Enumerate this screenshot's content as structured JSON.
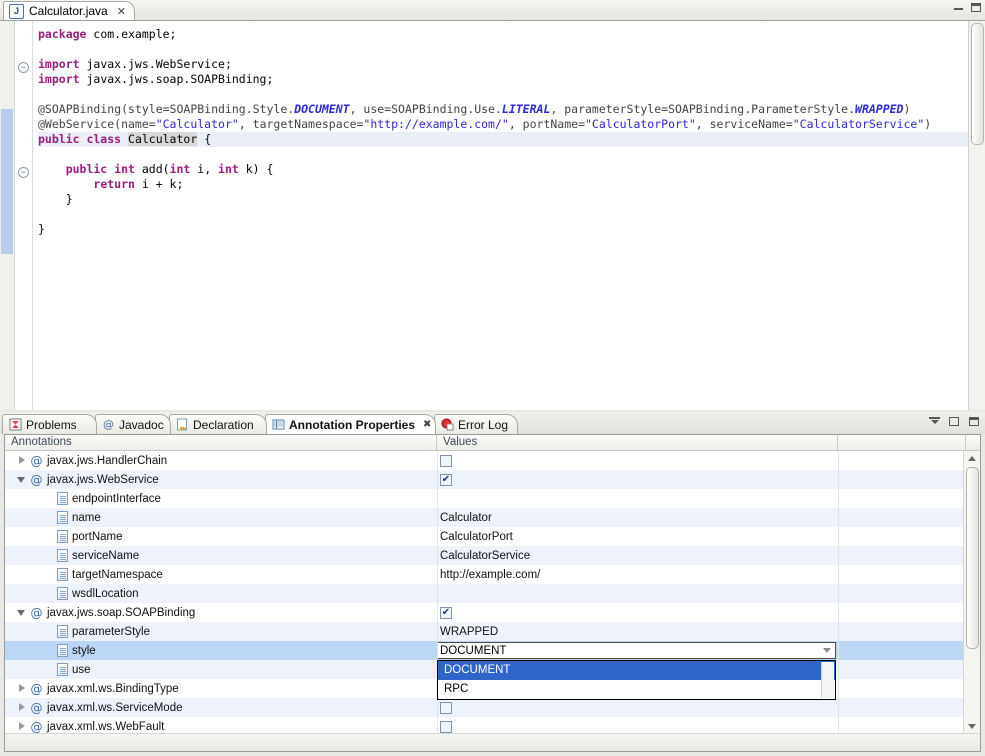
{
  "editor": {
    "tab": {
      "title": "Calculator.java",
      "close": "✕",
      "icon": "java-file-icon",
      "icon_letter": "J"
    },
    "window_controls": [
      "minimize",
      "maximize"
    ],
    "code_lines": [
      {
        "tokens": [
          {
            "t": "package ",
            "c": "kw"
          },
          {
            "t": "com.example;",
            "c": "plain"
          }
        ],
        "indent": 1
      },
      {
        "tokens": [],
        "indent": 0
      },
      {
        "tokens": [
          {
            "t": "import ",
            "c": "kw"
          },
          {
            "t": "javax.jws.WebService;",
            "c": "plain"
          }
        ],
        "indent": 0
      },
      {
        "tokens": [
          {
            "t": "import ",
            "c": "kw"
          },
          {
            "t": "javax.jws.soap.SOAPBinding;",
            "c": "plain"
          }
        ],
        "indent": 0
      },
      {
        "tokens": [],
        "indent": 0
      },
      {
        "tokens": [
          {
            "t": "@SOAPBinding(style=SOAPBinding.Style.",
            "c": "ann"
          },
          {
            "t": "DOCUMENT",
            "c": "italic"
          },
          {
            "t": ", use=SOAPBinding.Use.",
            "c": "ann"
          },
          {
            "t": "LITERAL",
            "c": "italic"
          },
          {
            "t": ", parameterStyle=SOAPBinding.ParameterStyle.",
            "c": "ann"
          },
          {
            "t": "WRAPPED",
            "c": "italic"
          },
          {
            "t": ")",
            "c": "ann"
          }
        ],
        "indent": 0
      },
      {
        "tokens": [
          {
            "t": "@WebService(name=",
            "c": "ann"
          },
          {
            "t": "\"Calculator\"",
            "c": "str"
          },
          {
            "t": ", targetNamespace=",
            "c": "ann"
          },
          {
            "t": "\"http://example.com/\"",
            "c": "str"
          },
          {
            "t": ", portName=",
            "c": "ann"
          },
          {
            "t": "\"CalculatorPort\"",
            "c": "str"
          },
          {
            "t": ", serviceName=",
            "c": "ann"
          },
          {
            "t": "\"CalculatorService\"",
            "c": "str"
          },
          {
            "t": ")",
            "c": "ann"
          }
        ],
        "indent": 0
      },
      {
        "tokens": [
          {
            "t": "public class ",
            "c": "kw"
          },
          {
            "t": "Calculator",
            "c": "occ"
          },
          {
            "t": " {",
            "c": "plain"
          }
        ],
        "indent": 0,
        "highlight": true
      },
      {
        "tokens": [],
        "indent": 0
      },
      {
        "tokens": [
          {
            "t": "    public int ",
            "c": "kw"
          },
          {
            "t": "add(",
            "c": "plain"
          },
          {
            "t": "int",
            "c": "kw"
          },
          {
            "t": " i, ",
            "c": "plain"
          },
          {
            "t": "int",
            "c": "kw"
          },
          {
            "t": " k) {",
            "c": "plain"
          }
        ],
        "indent": 1
      },
      {
        "tokens": [
          {
            "t": "        ",
            "c": "plain"
          },
          {
            "t": "return",
            "c": "kw"
          },
          {
            "t": " i + k;",
            "c": "plain"
          }
        ],
        "indent": 1
      },
      {
        "tokens": [
          {
            "t": "    }",
            "c": "plain"
          }
        ],
        "indent": 1
      },
      {
        "tokens": [],
        "indent": 0
      },
      {
        "tokens": [
          {
            "t": "}",
            "c": "plain"
          }
        ],
        "indent": 0
      }
    ],
    "fold_markers": [
      "⊖",
      "⊖"
    ]
  },
  "bottom_view": {
    "tabs": [
      {
        "label": "Problems",
        "icon": "problems-icon",
        "active": false,
        "closeable": false
      },
      {
        "label": "Javadoc",
        "icon": "javadoc-icon",
        "icon_glyph": "@",
        "active": false,
        "closeable": false
      },
      {
        "label": "Declaration",
        "icon": "declaration-icon",
        "active": false,
        "closeable": false
      },
      {
        "label": "Annotation Properties",
        "icon": "annotation-properties-icon",
        "active": true,
        "closeable": true,
        "close": "✖"
      },
      {
        "label": "Error Log",
        "icon": "error-log-icon",
        "active": false,
        "closeable": false
      }
    ],
    "view_controls": [
      "minimize-view",
      "maximize-view",
      "restore-view"
    ],
    "table": {
      "columns": [
        "Annotations",
        "Values"
      ],
      "rows": [
        {
          "name": "javax.jws.HandlerChain",
          "type": "annotation",
          "level": 0,
          "arrow": "collapsed",
          "value_kind": "checkbox",
          "checked": false
        },
        {
          "name": "javax.jws.WebService",
          "type": "annotation",
          "level": 0,
          "arrow": "expanded",
          "value_kind": "checkbox",
          "checked": true
        },
        {
          "name": "endpointInterface",
          "type": "attribute",
          "level": 1,
          "value_kind": "text",
          "value": ""
        },
        {
          "name": "name",
          "type": "attribute",
          "level": 1,
          "value_kind": "text",
          "value": "Calculator"
        },
        {
          "name": "portName",
          "type": "attribute",
          "level": 1,
          "value_kind": "text",
          "value": "CalculatorPort"
        },
        {
          "name": "serviceName",
          "type": "attribute",
          "level": 1,
          "value_kind": "text",
          "value": "CalculatorService"
        },
        {
          "name": "targetNamespace",
          "type": "attribute",
          "level": 1,
          "value_kind": "text",
          "value": "http://example.com/"
        },
        {
          "name": "wsdlLocation",
          "type": "attribute",
          "level": 1,
          "value_kind": "text",
          "value": ""
        },
        {
          "name": "javax.jws.soap.SOAPBinding",
          "type": "annotation",
          "level": 0,
          "arrow": "expanded",
          "value_kind": "checkbox",
          "checked": true
        },
        {
          "name": "parameterStyle",
          "type": "attribute",
          "level": 1,
          "value_kind": "text",
          "value": "WRAPPED"
        },
        {
          "name": "style",
          "type": "attribute",
          "level": 1,
          "value_kind": "combo",
          "value": "DOCUMENT",
          "selected": true
        },
        {
          "name": "use",
          "type": "attribute",
          "level": 1,
          "value_kind": "text",
          "value": ""
        },
        {
          "name": "javax.xml.ws.BindingType",
          "type": "annotation",
          "level": 0,
          "arrow": "collapsed",
          "value_kind": "checkbox",
          "checked": false
        },
        {
          "name": "javax.xml.ws.ServiceMode",
          "type": "annotation",
          "level": 0,
          "arrow": "collapsed",
          "value_kind": "checkbox",
          "checked": false
        },
        {
          "name": "javax.xml.ws.WebFault",
          "type": "annotation",
          "level": 0,
          "arrow": "collapsed",
          "value_kind": "checkbox",
          "checked": false,
          "clipped": true
        }
      ],
      "dropdown": {
        "open": true,
        "for_row": "style",
        "options": [
          "DOCUMENT",
          "RPC"
        ],
        "highlighted": "DOCUMENT"
      }
    }
  },
  "colors": {
    "selection_blue": "#bcd6f5",
    "dropdown_highlight": "#2f64c8",
    "alt_row": "#eef3fb",
    "keyword": "#9b1d7c",
    "string": "#2a2ad8",
    "annotation": "#444444"
  }
}
